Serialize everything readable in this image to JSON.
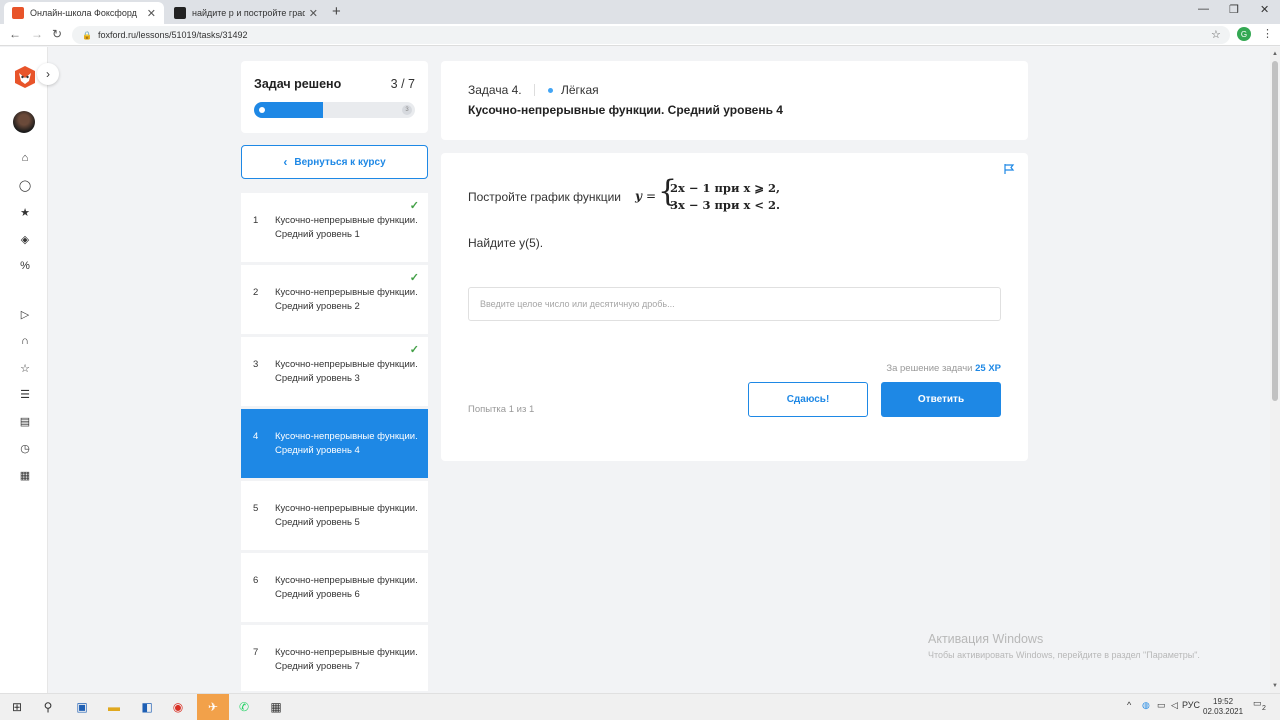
{
  "browser": {
    "tabs": [
      {
        "title": "Онлайн-школа Фоксфорд",
        "active": true,
        "favicon_color": "#e8542a"
      },
      {
        "title": "найдите р и постройте график",
        "active": false,
        "favicon_color": "#222222"
      }
    ],
    "url": "foxford.ru/lessons/51019/tasks/31492",
    "profile_initial": "G"
  },
  "sidebar_icons": [
    "home-icon",
    "chat-icon",
    "star-icon",
    "tag-icon",
    "percent-icon",
    "play-icon",
    "headphones-icon",
    "star-outline-icon",
    "list-icon",
    "stack-icon",
    "clock-icon",
    "notebook-icon"
  ],
  "progress": {
    "title": "Задач решено",
    "count": "3 / 7",
    "solved": 3,
    "total": 7,
    "end_label": "3"
  },
  "back_button": "Вернуться к курсу",
  "tasks": [
    {
      "num": "1",
      "name": "Кусочно-непрерывные функции. Средний уровень 1",
      "done": true,
      "active": false
    },
    {
      "num": "2",
      "name": "Кусочно-непрерывные функции. Средний уровень 2",
      "done": true,
      "active": false
    },
    {
      "num": "3",
      "name": "Кусочно-непрерывные функции. Средний уровень 3",
      "done": true,
      "active": false
    },
    {
      "num": "4",
      "name": "Кусочно-непрерывные функции. Средний уровень 4",
      "done": false,
      "active": true
    },
    {
      "num": "5",
      "name": "Кусочно-непрерывные функции. Средний уровень 5",
      "done": false,
      "active": false
    },
    {
      "num": "6",
      "name": "Кусочно-непрерывные функции. Средний уровень 6",
      "done": false,
      "active": false
    },
    {
      "num": "7",
      "name": "Кусочно-непрерывные функции. Средний уровень 7",
      "done": false,
      "active": false
    }
  ],
  "header": {
    "task_label": "Задача 4.",
    "level": "Лёгкая",
    "title": "Кусочно-непрерывные функции. Средний уровень 4"
  },
  "question": {
    "text": "Постройте график функции",
    "y": "y",
    "eq": "=",
    "line1": "2x − 1 при x ⩾ 2,",
    "line2": "3x − 3 при x < 2.",
    "find": "Найдите y(5).",
    "input_placeholder": "Введите целое число или десятичную дробь..."
  },
  "reward": {
    "text": "За решение задачи",
    "xp": "25 XP"
  },
  "attempt": "Попытка 1 из 1",
  "buttons": {
    "give_up": "Сдаюсь!",
    "answer": "Ответить"
  },
  "watermark": {
    "title": "Активация Windows",
    "text": "Чтобы активировать Windows, перейдите в раздел \"Параметры\"."
  },
  "taskbar": {
    "lang": "РУС",
    "time": "19:52",
    "date": "02.03.2021",
    "notifications": "2"
  }
}
